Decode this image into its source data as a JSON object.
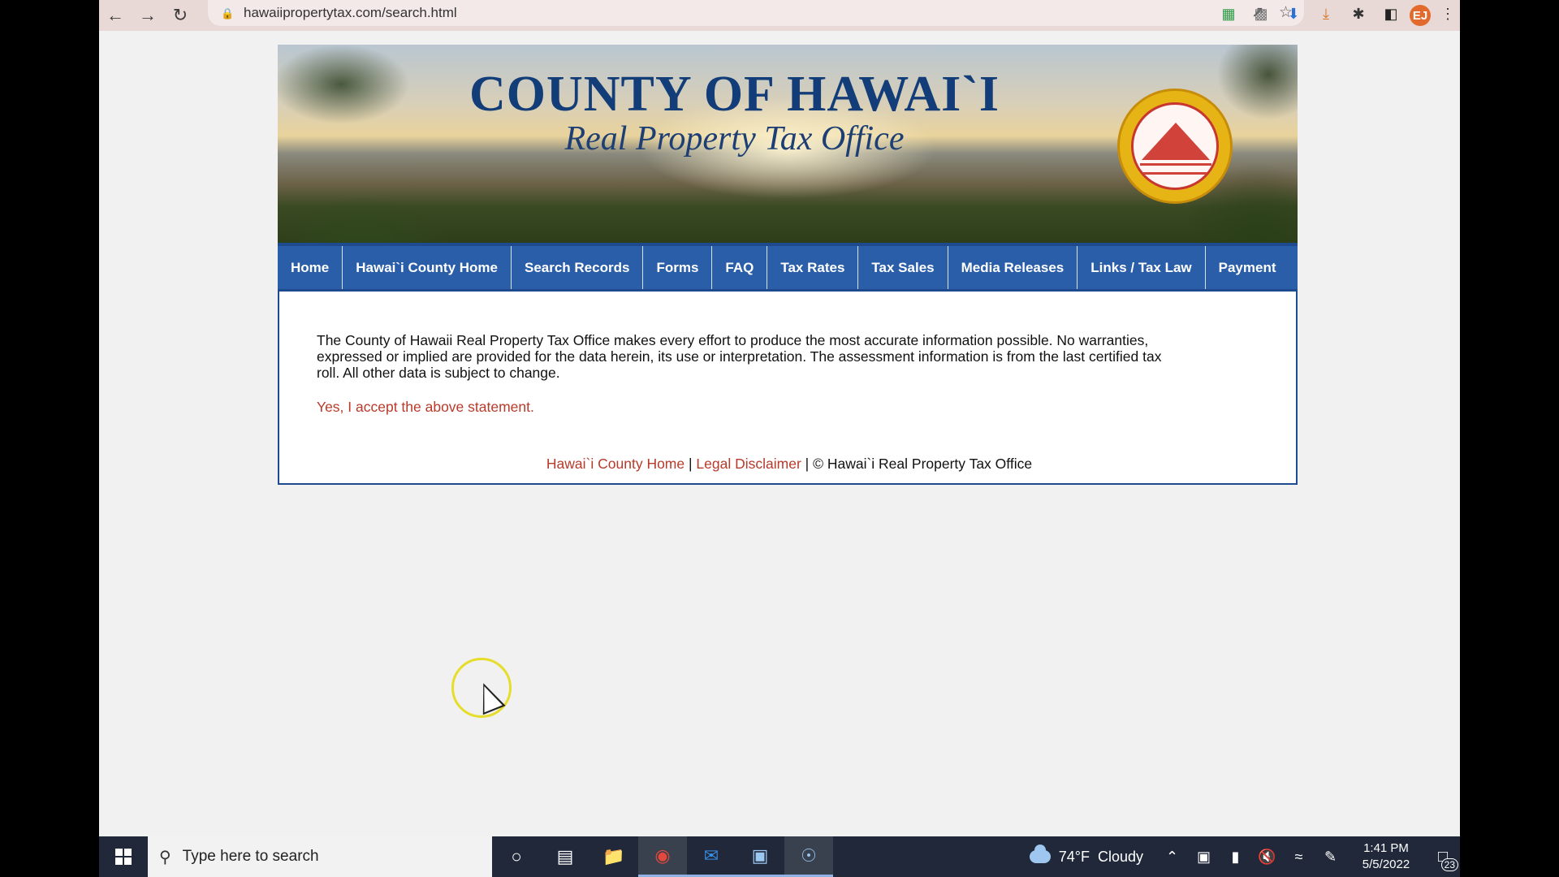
{
  "browser": {
    "url": "hawaiipropertytax.com/search.html",
    "profile_initials": "EJ"
  },
  "banner": {
    "title": "COUNTY OF HAWAI`I",
    "subtitle": "Real Property Tax Office"
  },
  "nav": {
    "items": [
      "Home",
      "Hawai`i  County Home",
      "Search Records",
      "Forms",
      "FAQ",
      "Tax Rates",
      "Tax Sales",
      "Media Releases",
      "Links / Tax Law",
      "Payment"
    ]
  },
  "content": {
    "notice": "The County of Hawaii Real Property Tax Office makes every effort to produce the most accurate information possible. No warranties, expressed or implied are provided for the data herein, its use or interpretation. The assessment information is from the last certified tax roll. All other data is subject to change.",
    "accept_link": "Yes, I accept the above statement."
  },
  "footer": {
    "county_home": "Hawai`i  County Home",
    "sep": "|",
    "legal": "Legal Disclaimer",
    "copyright": "© Hawai`i Real Property Tax Office"
  },
  "taskbar": {
    "search_placeholder": "Type here to search",
    "weather_temp": "74°F",
    "weather_desc": "Cloudy",
    "time": "1:41 PM",
    "date": "5/5/2022",
    "notifications": "23"
  },
  "colors": {
    "nav_blue": "#2b5ea8",
    "link_red": "#b83a2a",
    "title_blue": "#123d78"
  }
}
